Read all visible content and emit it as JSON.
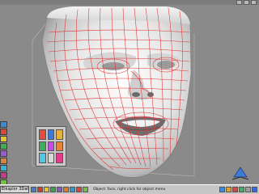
{
  "window": {
    "title": ""
  },
  "taskbar": {
    "start_label": "Eiksplor 3DatA",
    "status_text": "Object: face, right click for object menu",
    "task_icons": [
      "#4c7ac9",
      "#d33b2c",
      "#e7c02e",
      "#3aa24b",
      "#8b58c7",
      "#e07b2b",
      "#2e9bd6",
      "#c4c4c4",
      "#d9463b",
      "#5fb0d8",
      "#7bbd42",
      "#e2d04b",
      "#b05e2d",
      "#6a6ad6"
    ],
    "right_icons": [
      "#3b8ad8",
      "#d8a43b",
      "#c44e4e",
      "#4ea86a",
      "#9d9d9d",
      "#3b6ad8",
      "#d8d03b",
      "#7a4ed8"
    ]
  },
  "left_toolbar": {
    "icons": [
      "#3b8ad8",
      "#d84b3b",
      "#e6c23b",
      "#3bb04f",
      "#9a5ad8",
      "#d8843b",
      "#3bb0d8",
      "#c33b8a",
      "#77c23b",
      "#d8d83b",
      "#4b4bd8"
    ]
  },
  "material_palette": {
    "swatches": [
      "#e64a3b",
      "#3b7ad8",
      "#e6b23b",
      "#3bb05a",
      "#c94be6",
      "#e6823b",
      "#4bc9e6",
      "#d8d8d8",
      "#e63b8a"
    ]
  },
  "viewport": {
    "model_label": "3D head wireframe model",
    "colors": {
      "surface": "#ffffff",
      "wireframe": "#e03030",
      "background": "#8a8a8a",
      "guide": "#b8b8b8"
    }
  }
}
